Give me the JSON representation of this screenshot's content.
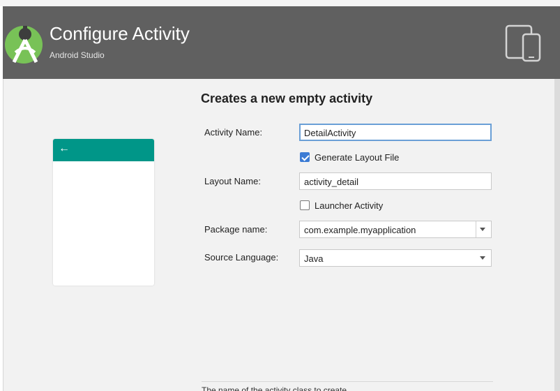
{
  "header": {
    "title": "Configure Activity",
    "subtitle": "Android Studio"
  },
  "preview": {
    "back_arrow": "←",
    "toolbar_color": "#009688"
  },
  "form": {
    "title": "Creates a new empty activity",
    "activity_name_label": "Activity Name:",
    "activity_name_value": "DetailActivity",
    "generate_layout_label": "Generate Layout File",
    "generate_layout_checked": true,
    "layout_name_label": "Layout Name:",
    "layout_name_value": "activity_detail",
    "launcher_label": "Launcher Activity",
    "launcher_checked": false,
    "package_label": "Package name:",
    "package_value": "com.example.myapplication",
    "language_label": "Source Language:",
    "language_value": "Java"
  },
  "footer": {
    "hint": "The name of the activity class to create"
  },
  "colors": {
    "header_bg": "#606060",
    "accent": "#3b7bd4",
    "focus_border": "#6a9fd6"
  }
}
